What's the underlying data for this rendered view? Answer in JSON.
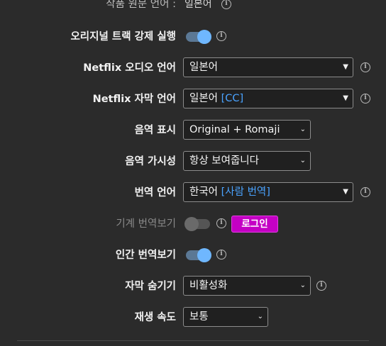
{
  "original_language": {
    "label": "작품 원문 언어 :",
    "value": "일본어"
  },
  "force_original_track": {
    "label": "오리지널 트랙 강제 실행",
    "on": true
  },
  "netflix_audio": {
    "label": "Netflix 오디오 언어",
    "value": "일본어"
  },
  "netflix_subtitle": {
    "label": "Netflix 자막 언어",
    "value": "일본어",
    "value_cc": "[CC]"
  },
  "phonetic_display": {
    "label": "음역 표시",
    "value": "Original + Romaji"
  },
  "phonetic_visibility": {
    "label": "음역 가시성",
    "value": "항상 보여줍니다"
  },
  "translation_language": {
    "label": "번역 언어",
    "value": "한국어",
    "value_tag": "[사람 번역]"
  },
  "machine_translation": {
    "label": "기계 번역보기",
    "on": false,
    "login_label": "로그인"
  },
  "human_translation": {
    "label": "인간 번역보기",
    "on": true
  },
  "hide_subtitles": {
    "label": "자막 숨기기",
    "value": "비활성화"
  },
  "playback_speed": {
    "label": "재생 속도",
    "value": "보통"
  },
  "icons": {
    "info": "info-circle-icon",
    "dropdown": "caret-down-icon"
  },
  "colors": {
    "accent": "#6fb7ff",
    "login_button": "#c400c4",
    "cc_text": "#4aa3ff"
  }
}
